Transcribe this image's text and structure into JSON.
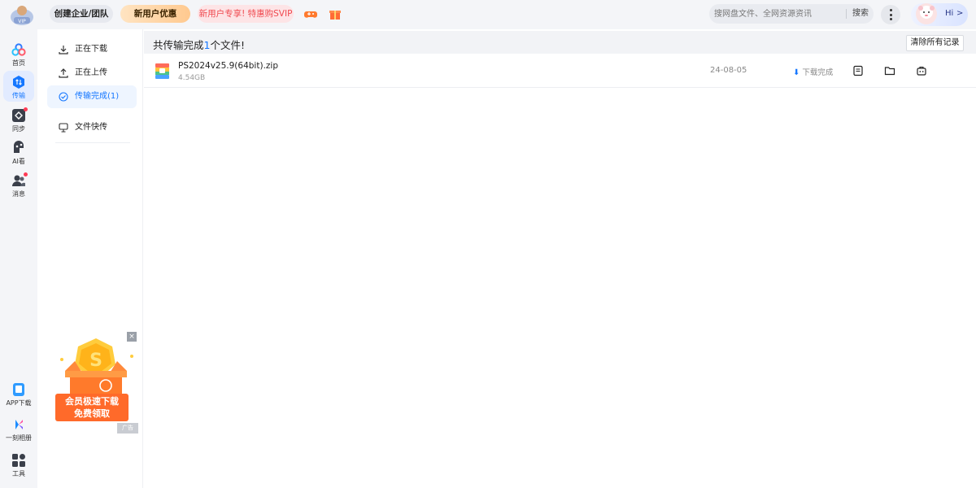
{
  "topbar": {
    "create_team": "创建企业/团队",
    "new_user_offer": "新用户优惠",
    "svip_promo": "新用户专享! 特惠购SVIP",
    "search_placeholder": "搜网盘文件、全网资源资讯",
    "search_button": "搜索",
    "greeting": "Hi",
    "chevron": ">"
  },
  "leftnav": {
    "items": [
      {
        "label": "首页",
        "icon": "cloud-icon"
      },
      {
        "label": "传输",
        "icon": "transfer-icon"
      },
      {
        "label": "同步",
        "icon": "sync-icon"
      },
      {
        "label": "AI看",
        "icon": "ai-icon"
      },
      {
        "label": "消息",
        "icon": "message-icon"
      }
    ],
    "bottom": [
      {
        "label": "APP下载",
        "icon": "phone-icon"
      },
      {
        "label": "一刻相册",
        "icon": "album-icon"
      },
      {
        "label": "工具",
        "icon": "tools-icon"
      }
    ]
  },
  "subnav": {
    "items": [
      {
        "label": "正在下载",
        "icon": "download-icon"
      },
      {
        "label": "正在上传",
        "icon": "upload-icon"
      },
      {
        "label": "传输完成(1)",
        "icon": "check-circle-icon"
      },
      {
        "label": "文件快传",
        "icon": "quick-transfer-icon"
      }
    ],
    "ad": {
      "line1": "会员极速下载",
      "line2": "免费领取",
      "close": "×",
      "tag": "广告"
    }
  },
  "main": {
    "summary_prefix": "共传输完成",
    "summary_count": "1",
    "summary_suffix": "个文件!",
    "clear_button": "清除所有记录",
    "files": [
      {
        "name": "PS2024v25.9(64bit).zip",
        "size": "4.54GB",
        "date": "24-08-05",
        "status": "下载完成"
      }
    ]
  },
  "colors": {
    "accent": "#1677ff",
    "svip_red": "#f0484e",
    "sidebar_bg": "#f4f5f8"
  }
}
